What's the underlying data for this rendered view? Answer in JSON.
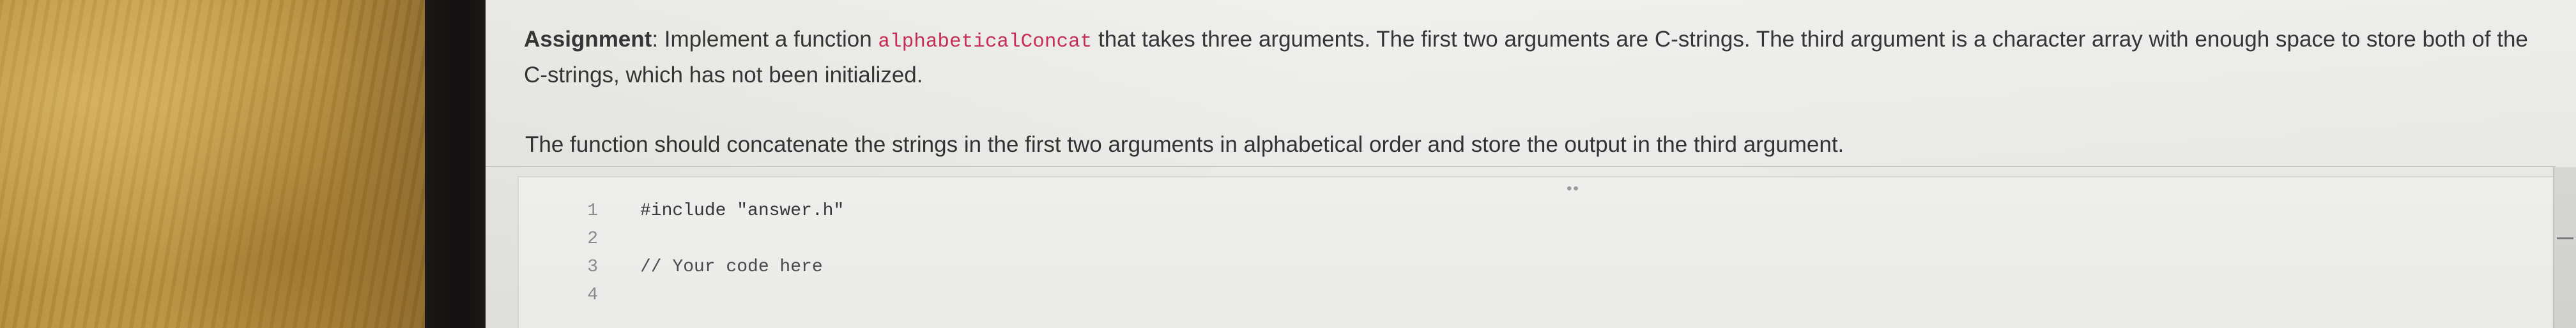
{
  "assignment": {
    "label": "Assignment",
    "text_before_code": "Implement a function ",
    "function_name": "alphabeticalConcat",
    "text_after_code": " that takes three arguments. The first two arguments are C-strings. The third argument is a character array with enough space to store both of the C-strings, which has not been initialized."
  },
  "instruction": "The function should concatenate the strings in the first two arguments in alphabetical order and store the output in the third argument.",
  "editor": {
    "resize_handle": "••",
    "lines": [
      {
        "number": "1",
        "text": "#include \"answer.h\""
      },
      {
        "number": "2",
        "text": ""
      },
      {
        "number": "3",
        "text": "// Your code here"
      },
      {
        "number": "4",
        "text": ""
      }
    ]
  },
  "colors": {
    "code_highlight": "#c7254e",
    "body_text": "#2c2c2c",
    "editor_background": "#f3f3f1"
  }
}
